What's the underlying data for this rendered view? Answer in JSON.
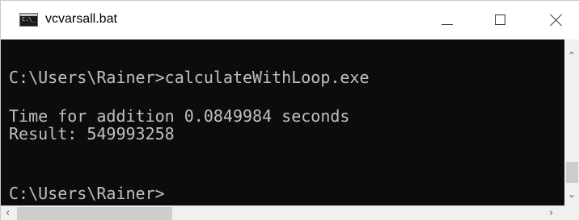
{
  "window": {
    "title": "vcvarsall.bat",
    "app_icon_text": "C:\\_"
  },
  "console": {
    "lines": [
      "C:\\Users\\Rainer>calculateWithLoop.exe",
      "Time for addition 0.0849984 seconds",
      "Result: 549993258",
      "C:\\Users\\Rainer>"
    ]
  },
  "colors": {
    "console_background": "#0c0c0c",
    "console_text": "#c0c0c0",
    "titlebar": "#ffffff",
    "scrollbar_track": "#f0f0f0",
    "scrollbar_thumb": "#cdcdcd"
  },
  "icons": {
    "minimize": "minimize-icon",
    "maximize": "maximize-icon",
    "close": "close-icon",
    "scroll_up": "chevron-up-icon",
    "scroll_down": "chevron-down-icon",
    "scroll_left": "chevron-left-icon",
    "scroll_right": "chevron-right-icon"
  }
}
